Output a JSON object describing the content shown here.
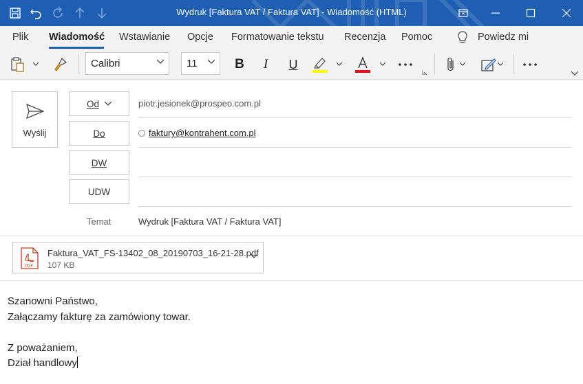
{
  "window": {
    "title": "Wydruk [Faktura VAT / Faktura VAT]  -  Wiadomość (HTML)"
  },
  "colors": {
    "titlebar": "#1e5fb3",
    "accent": "#1e5fb3",
    "highlight_yellow": "#ffff00",
    "font_color_red": "#e81123"
  },
  "menu": {
    "tabs": [
      "Plik",
      "Wiadomość",
      "Wstawianie",
      "Opcje",
      "Formatowanie tekstu",
      "Recenzja",
      "Pomoc"
    ],
    "active": "Wiadomość",
    "tell_me": "Powiedz mi"
  },
  "ribbon": {
    "font_name": "Calibri",
    "font_size": "11",
    "icons": [
      "paste-icon",
      "format-painter-icon",
      "bold-icon",
      "italic-icon",
      "underline-icon",
      "highlight-icon",
      "font-color-icon",
      "more-icon",
      "attach-icon",
      "signature-icon",
      "more-options-icon"
    ]
  },
  "compose": {
    "send_label": "Wyślij",
    "from_label": "Od",
    "to_label": "Do",
    "cc_label": "DW",
    "bcc_label": "UDW",
    "from_value": "piotr.jesionek@prospeo.com.pl",
    "to_value": "faktury@kontrahent.com.pl",
    "subject_label": "Temat",
    "subject_value": "Wydruk [Faktura VAT / Faktura VAT]"
  },
  "attachment": {
    "filename": "Faktura_VAT_FS-13402_08_20190703_16-21-28.pdf",
    "size": "107 KB",
    "type_label": "PDF"
  },
  "body": {
    "lines": [
      "Szanowni Państwo,",
      "Załączamy fakturę za zamówiony towar.",
      "",
      "Z poważaniem,",
      "Dział handlowy"
    ]
  }
}
